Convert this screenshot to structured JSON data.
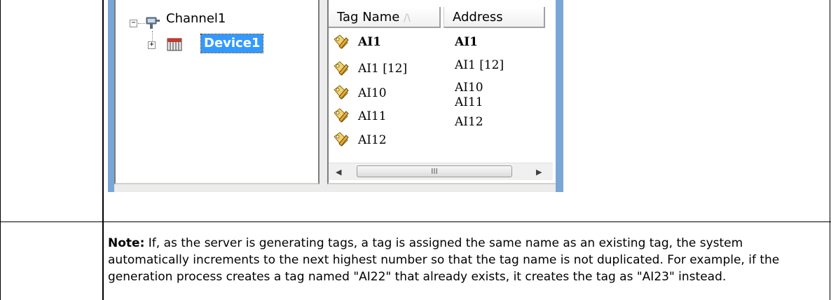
{
  "tree": {
    "root_label": "Channel1",
    "child_label": "Device1",
    "root_expander": "−",
    "child_expander": "+"
  },
  "list": {
    "columns": [
      "Tag Name",
      "Address"
    ],
    "sort_indicator": "/\\",
    "rows": [
      {
        "name": "AI1",
        "address": "AI1",
        "bold": true
      },
      {
        "name": "AI1 [12]",
        "address": "AI1 [12]",
        "bold": false
      },
      {
        "name": "AI10",
        "address": "AI10",
        "bold": false
      },
      {
        "name": "AI11",
        "address": "AI11",
        "bold": false
      },
      {
        "name": "AI12",
        "address": "AI12",
        "bold": false
      }
    ]
  },
  "scrollbar": {
    "left_arrow": "◀",
    "right_arrow": "▶",
    "thumb_grip": "III"
  },
  "note": {
    "label": "Note:",
    "text": " If, as the server is generating tags, a tag is assigned the same name as an existing tag, the system automatically increments to the next highest number so that the tag name is not duplicated. For example, if the generation process creates a tag named \"AI22\" that already exists, it creates the tag as \"AI23\" instead."
  },
  "colors": {
    "frame": "#7aa6d6",
    "selection": "#3399ff"
  }
}
